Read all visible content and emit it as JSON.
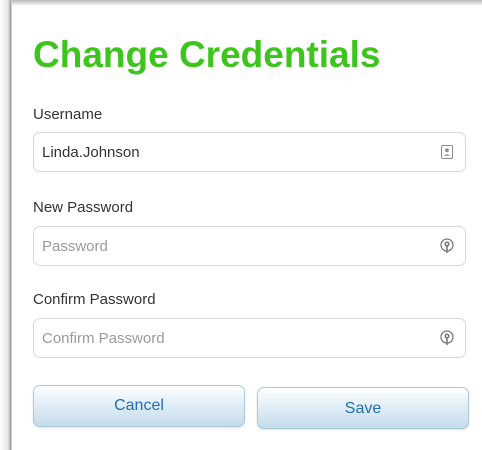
{
  "dialog": {
    "title": "Change Credentials",
    "accent_color": "#3dc51d"
  },
  "fields": {
    "username": {
      "label": "Username",
      "value": "Linda.Johnson",
      "placeholder": "",
      "icon": "contact-card-icon"
    },
    "new_password": {
      "label": "New Password",
      "value": "",
      "placeholder": "Password",
      "icon": "password-key-icon"
    },
    "confirm_password": {
      "label": "Confirm Password",
      "value": "",
      "placeholder": "Confirm Password",
      "icon": "password-key-icon"
    }
  },
  "buttons": {
    "cancel_label": "Cancel",
    "save_label": "Save",
    "text_color": "#1f6fb0"
  }
}
